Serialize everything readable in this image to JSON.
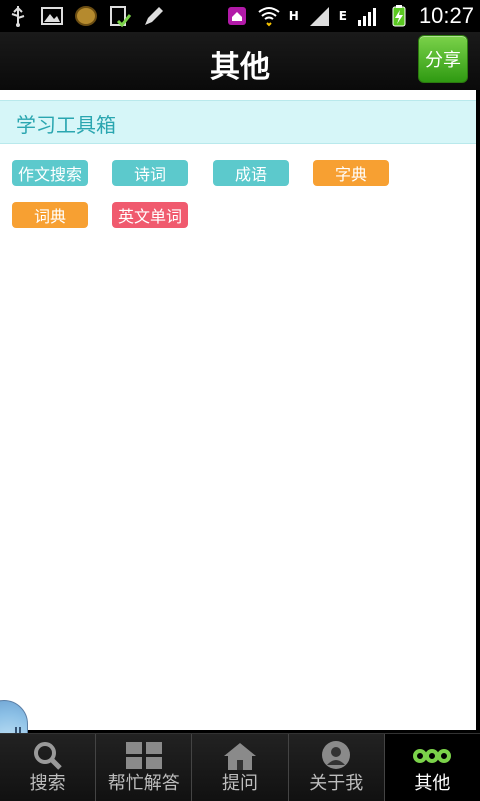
{
  "status_bar": {
    "time": "10:27",
    "net_h": "H",
    "net_e": "E"
  },
  "header": {
    "title": "其他",
    "share_label": "分享"
  },
  "section": {
    "title": "学习工具箱"
  },
  "tools": [
    {
      "label": "作文搜索",
      "color": "#5cc9cc"
    },
    {
      "label": "诗词",
      "color": "#5cc9cc"
    },
    {
      "label": "成语",
      "color": "#5cc9cc"
    },
    {
      "label": "字典",
      "color": "#f7a032"
    },
    {
      "label": "词典",
      "color": "#f7a032"
    },
    {
      "label": "英文单词",
      "color": "#f05a6e"
    }
  ],
  "tabs": [
    {
      "label": "搜索",
      "icon": "search-icon"
    },
    {
      "label": "帮忙解答",
      "icon": "grid-icon"
    },
    {
      "label": "提问",
      "icon": "home-icon"
    },
    {
      "label": "关于我",
      "icon": "person-icon"
    },
    {
      "label": "其他",
      "icon": "more-icon",
      "active": true
    }
  ]
}
